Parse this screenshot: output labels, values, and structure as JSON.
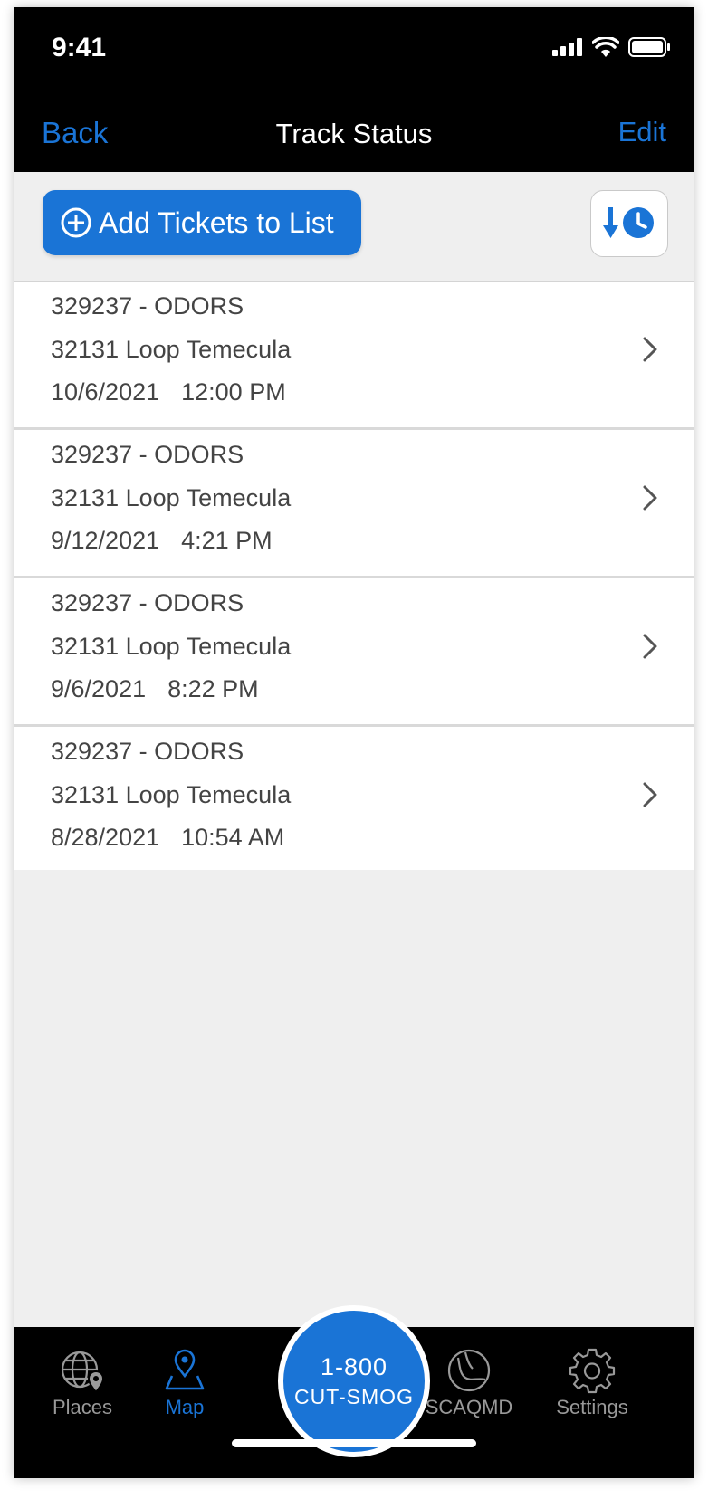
{
  "status_bar": {
    "time": "9:41"
  },
  "nav": {
    "back_label": "Back",
    "title": "Track Status",
    "edit_label": "Edit"
  },
  "toolbar": {
    "add_label": "Add Tickets to List",
    "sort_icon": "sort-down-clock-icon"
  },
  "tickets": [
    {
      "title": "329237 - ODORS",
      "address": "32131 Loop Temecula",
      "date": "10/6/2021",
      "time": "12:00 PM"
    },
    {
      "title": "329237 - ODORS",
      "address": "32131 Loop Temecula",
      "date": "9/12/2021",
      "time": "4:21 PM"
    },
    {
      "title": "329237 - ODORS",
      "address": "32131 Loop Temecula",
      "date": "9/6/2021",
      "time": "8:22 PM"
    },
    {
      "title": "329237 - ODORS",
      "address": "32131 Loop Temecula",
      "date": "8/28/2021",
      "time": "10:54 AM"
    }
  ],
  "tabbar": {
    "places_label": "Places",
    "map_label": "Map",
    "center_line1": "1-800",
    "center_line2": "CUT-SMOG",
    "scaqmd_label": "SCAQMD",
    "settings_label": "Settings"
  },
  "colors": {
    "accent": "#1a74d6",
    "bar_bg": "#000000",
    "content_bg": "#efefef"
  }
}
